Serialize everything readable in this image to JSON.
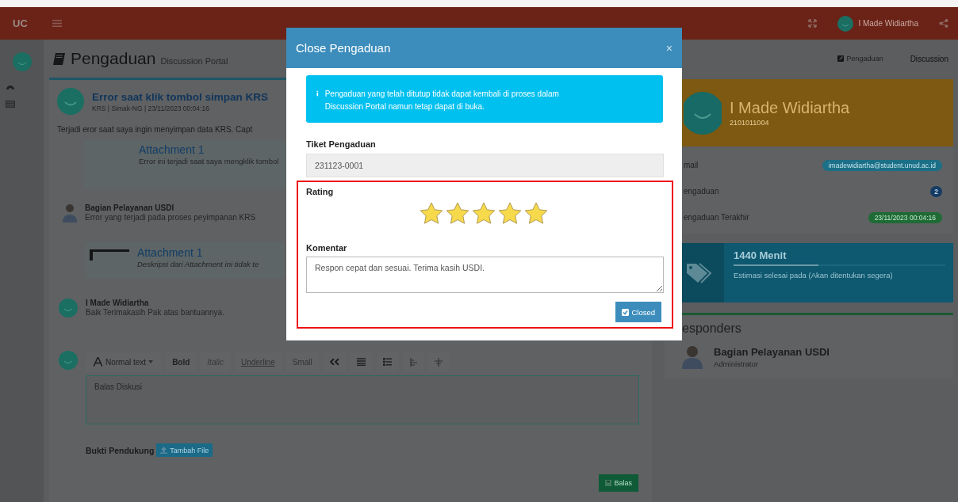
{
  "navbar": {
    "logo": "UC",
    "user_name": "I Made Widiartha"
  },
  "header": {
    "title": "Pengaduan",
    "subtitle": "Discussion Portal",
    "breadcrumb": [
      "Pengaduan",
      "Discussion"
    ]
  },
  "ticket": {
    "title": "Error saat klik tombol simpan KRS",
    "meta": "KRS | Simak-NG | 23/11/2023 00:04:16",
    "body": "Terjadi eror saat saya ingin menyimpan data KRS. Capt",
    "attachment": {
      "title": "Attachment 1",
      "description": "Error ini terjadi saat saya mengklik tombol"
    }
  },
  "replies": [
    {
      "kind": "admin",
      "name": "Bagian Pelayanan USDI",
      "text": "Error yang terjadi pada proses peyimpanan KRS",
      "attachment": {
        "title": "Attachment 1",
        "description": "Deskripsi dari Attachment ini tidak te"
      }
    },
    {
      "kind": "user",
      "name": "I Made Widiartha",
      "text": "Baik Terimakasih Pak atas bantuannya."
    }
  ],
  "editor": {
    "toolbar": [
      {
        "kind": "dropdown",
        "label": "Normal text"
      },
      {
        "kind": "bold",
        "label": "Bold"
      },
      {
        "kind": "italic",
        "label": "Italic"
      },
      {
        "kind": "underline",
        "label": "Underline"
      },
      {
        "kind": "small",
        "label": "Small"
      }
    ],
    "placeholder": "Balas Diskusi",
    "attach_label": "Bukti Pendukung",
    "attach_button": "Tambah File",
    "submit": "Balas"
  },
  "profile": {
    "name": "I Made Widiartha",
    "nim": "2101011004",
    "stats": [
      {
        "label": "mail",
        "value": "imadewidiartha@student.unud.ac.id",
        "color": "#1b6f86"
      },
      {
        "label": "engaduan",
        "value": "2",
        "color": "#143b63"
      },
      {
        "label": "engaduan Terakhir",
        "value": "23/11/2023 00:04:16",
        "color": "#1f6b35"
      }
    ]
  },
  "estimate": {
    "title": "1440 Menit",
    "level": 0.4,
    "text": "Estimasi selesai pada (Akan ditentukan segera)"
  },
  "responders": {
    "title": "esponders",
    "items": [
      {
        "name": "Bagian Pelayanan USDI",
        "role": "Administrator"
      }
    ]
  },
  "modal": {
    "title": "Close Pengaduan",
    "close": "×",
    "alert": "Pengaduan yang telah ditutup tidak dapat kembali di proses dalam Discussion Portal namun tetap dapat di buka.",
    "ticket_label": "Tiket Pengaduan",
    "ticket_value": "231123-0001",
    "rating_label": "Rating",
    "rating": {
      "stars": 5
    },
    "comment_label": "Komentar",
    "comment": "Respon cepat dan sesuai. Terima kasih USDI.",
    "button": "Closed"
  }
}
